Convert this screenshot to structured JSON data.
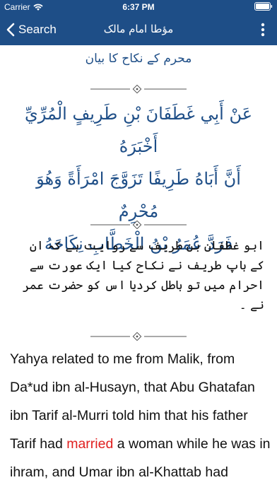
{
  "status_bar": {
    "carrier": "Carrier",
    "time": "6:37 PM",
    "battery_color": "#ffffff"
  },
  "nav": {
    "back_label": "Search",
    "title": "مؤطا امام مالک",
    "back_icon": "chevron-left-icon",
    "more_icon": "more-vertical-icon"
  },
  "chapter": {
    "title": "محرم کے نکاح کا بیان"
  },
  "hadith": {
    "arabic_lines": [
      "عَنْ أَبِي غَطَفَانَ بْنِ طَرِيفٍ الْمُرِّيِّ أَخْبَرَهُ",
      "أَنَّ أَبَاهُ طَرِيفًا تَزَوَّجَ امْرَأَةً وَهُوَ مُحْرِمٌ",
      "فَرَدَّ عُمَرُ بْنُ الْخَطَّابِ نِكَاحَهُ"
    ],
    "urdu_text": "ابو غطفان بن طریف سے روایت ہے کہ ان کے باپ طریف نے نکاح کیا ایک عورت سے احرام میں تو باطل کردیا اس کو حضرت عمر نے ۔",
    "english_before": "Yahya related to me from Malik, from Da*ud ibn al-Husayn, that Abu Ghatafan ibn Tarif al-Murri told him that his father Tarif had ",
    "english_highlight": "married",
    "english_after": " a woman while he was in ihram, and Umar ibn al-Khattab had rescinded the marriage."
  },
  "colors": {
    "accent": "#1e4e87",
    "highlight": "#e02020"
  }
}
